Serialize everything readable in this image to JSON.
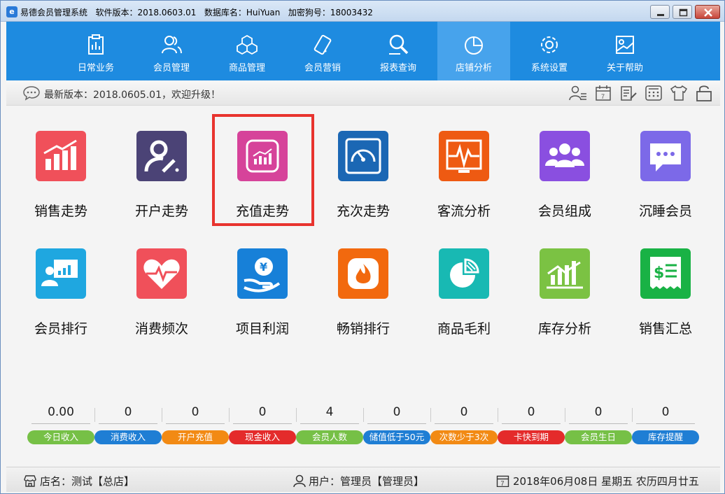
{
  "window": {
    "title": "易德会员管理系统",
    "version_label": "软件版本：2018.0603.01",
    "db_label": "数据库名：HuiYuan",
    "dongle_label": "加密狗号：18003432"
  },
  "nav": {
    "items": [
      {
        "label": "日常业务",
        "icon": "clipboard-icon"
      },
      {
        "label": "会员管理",
        "icon": "members-icon"
      },
      {
        "label": "商品管理",
        "icon": "cubes-icon"
      },
      {
        "label": "会员营销",
        "icon": "phone-icon"
      },
      {
        "label": "报表查询",
        "icon": "search-report-icon"
      },
      {
        "label": "店铺分析",
        "icon": "pie-chart-icon",
        "active": true
      },
      {
        "label": "系统设置",
        "icon": "gear-icon"
      },
      {
        "label": "关于帮助",
        "icon": "help-icon"
      }
    ]
  },
  "notice": {
    "text": "最新版本：2018.0605.01，欢迎升级！"
  },
  "tiles": [
    {
      "label": "销售走势",
      "color": "#f0505a",
      "icon": "bar-trend-icon"
    },
    {
      "label": "开户走势",
      "color": "#4b4376",
      "icon": "user-pen-icon"
    },
    {
      "label": "充值走势",
      "color": "#d6439a",
      "icon": "recharge-trend-icon"
    },
    {
      "label": "充次走势",
      "color": "#1b67b4",
      "icon": "gauge-icon"
    },
    {
      "label": "客流分析",
      "color": "#ee5a12",
      "icon": "pulse-icon"
    },
    {
      "label": "会员组成",
      "color": "#8a4fe0",
      "icon": "group-icon"
    },
    {
      "label": "沉睡会员",
      "color": "#7c69e8",
      "icon": "chat-icon"
    },
    {
      "label": "会员排行",
      "color": "#1fa7e0",
      "icon": "presenter-icon"
    },
    {
      "label": "消费频次",
      "color": "#f0505a",
      "icon": "heartbeat-icon"
    },
    {
      "label": "项目利润",
      "color": "#1780d8",
      "icon": "yuan-hand-icon"
    },
    {
      "label": "畅销排行",
      "color": "#f2690e",
      "icon": "flame-icon"
    },
    {
      "label": "商品毛利",
      "color": "#18b9b3",
      "icon": "pie-icon"
    },
    {
      "label": "库存分析",
      "color": "#7bc243",
      "icon": "stock-chart-icon"
    },
    {
      "label": "销售汇总",
      "color": "#19b245",
      "icon": "receipt-icon"
    }
  ],
  "stats": [
    {
      "value": "0.00",
      "label": "今日收入",
      "color": "#76c046"
    },
    {
      "value": "0",
      "label": "消费收入",
      "color": "#1f7ed4"
    },
    {
      "value": "0",
      "label": "开户充值",
      "color": "#f28a14"
    },
    {
      "value": "0",
      "label": "现金收入",
      "color": "#e42b2b"
    },
    {
      "value": "4",
      "label": "会员人数",
      "color": "#76c046"
    },
    {
      "value": "0",
      "label": "储值低于50元",
      "color": "#1f7ed4"
    },
    {
      "value": "0",
      "label": "次数少于3次",
      "color": "#f28a14"
    },
    {
      "value": "0",
      "label": "卡快到期",
      "color": "#e42b2b"
    },
    {
      "value": "0",
      "label": "会员生日",
      "color": "#76c046"
    },
    {
      "value": "0",
      "label": "库存提醒",
      "color": "#1f7ed4"
    }
  ],
  "status": {
    "store": "店名：测试【总店】",
    "user": "用户：管理员【管理员】",
    "date": "2018年06月08日 星期五 农历四月廿五"
  }
}
